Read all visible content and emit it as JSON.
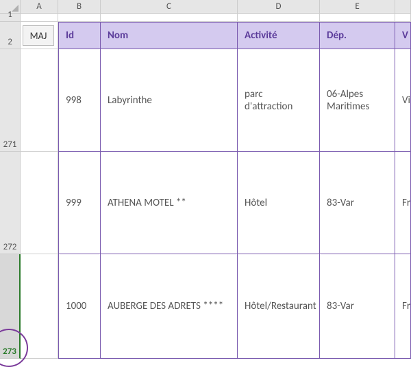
{
  "columns": {
    "A": "A",
    "B": "B",
    "C": "C",
    "D": "D",
    "E": "E"
  },
  "row_labels": {
    "r1": "1",
    "r2": "2",
    "r271": "271",
    "r272": "272",
    "r273": "273"
  },
  "button_label": "MAJ",
  "headers": {
    "id": "Id",
    "nom": "Nom",
    "activite": "Activité",
    "dep": "Dép.",
    "ville": "V"
  },
  "rows": [
    {
      "id": "998",
      "nom": "Labyrinthe",
      "activite": "parc d'attraction",
      "dep": "06-Alpes Maritimes",
      "ville": "Vi"
    },
    {
      "id": "999",
      "nom": "ATHENA MOTEL **",
      "activite": "Hôtel",
      "dep": "83-Var",
      "ville": "Fr"
    },
    {
      "id": "1000",
      "nom": "AUBERGE DES ADRETS ****",
      "activite": "Hôtel/Restaurant",
      "dep": "83-Var",
      "ville": "Fr"
    }
  ],
  "col_widths": {
    "A": 55,
    "B": 62,
    "C": 200,
    "D": 120,
    "E": 110,
    "F": 23
  },
  "row_heights": {
    "r1": 12,
    "r2": 40,
    "r271": 150,
    "r272": 150,
    "r273": 153
  }
}
